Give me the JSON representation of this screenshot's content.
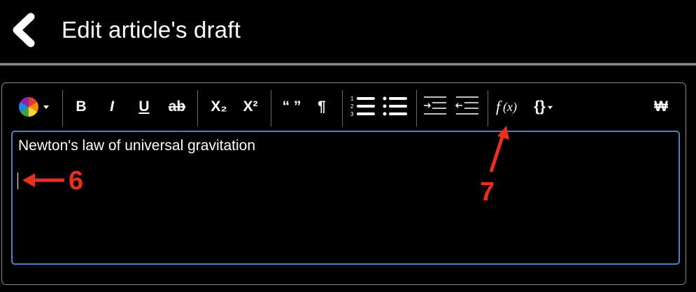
{
  "header": {
    "title": "Edit article's draft"
  },
  "toolbar": {
    "bold_label": "B",
    "italic_label": "I",
    "underline_label": "U",
    "strikethrough_label": "ab",
    "subscript_label": "X₂",
    "superscript_label": "X²",
    "quote_label": "“ ”",
    "paragraph_label": "¶",
    "code_label": "{}",
    "special_char_label": "₩",
    "icons": [
      "color-wheel-icon",
      "chevron-down-icon",
      "ordered-list-icon",
      "unordered-list-icon",
      "indent-icon",
      "outdent-icon",
      "function-icon",
      "code-braces-icon"
    ]
  },
  "editor": {
    "content_line1": "Newton's law of universal gravitation"
  },
  "annotations": {
    "label_6": "6",
    "label_7": "7",
    "color": "#e63024"
  }
}
